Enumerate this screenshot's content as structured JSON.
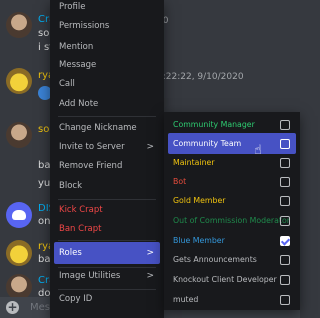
{
  "chat": {
    "messages": [
      {
        "author": "Cra",
        "lines": [
          "sor",
          "i st"
        ],
        "stamp": "20"
      },
      {
        "author": "rya",
        "stamp": "2:22:22, 9/10/2020"
      },
      {
        "author": "soc",
        "lines": [
          "bar",
          "yuc"
        ],
        "stamp": "02"
      },
      {
        "author": "DIS",
        "lines": [
          "onl"
        ],
        "stamp": "40"
      },
      {
        "author": "rya",
        "lines": [
          "bar"
        ],
        "stamp": "0"
      },
      {
        "author": "Cra",
        "lines": [
          "dow"
        ],
        "stamp": "20"
      }
    ],
    "composer_placeholder": "Mess"
  },
  "menu": {
    "items": [
      {
        "label": "Profile"
      },
      {
        "label": "Permissions"
      },
      {
        "label": "Mention"
      },
      {
        "label": "Message"
      },
      {
        "label": "Call"
      },
      {
        "label": "Add Note"
      },
      {
        "label": "Change Nickname"
      },
      {
        "label": "Invite to Server",
        "chevron": ">"
      },
      {
        "label": "Remove Friend"
      },
      {
        "label": "Block"
      },
      {
        "label": "Kick Crapt"
      },
      {
        "label": "Ban Crapt"
      },
      {
        "label": "Roles",
        "chevron": ">"
      },
      {
        "label": "Image Utilities",
        "chevron": ">"
      },
      {
        "label": "Copy ID"
      }
    ]
  },
  "roles": {
    "items": [
      {
        "label": "Community Manager",
        "color": "#2ecc71",
        "checked": false
      },
      {
        "label": "Community Team",
        "color": "#ffffff",
        "checked": false
      },
      {
        "label": "Maintainer",
        "color": "#f1c40f",
        "checked": false
      },
      {
        "label": "Bot",
        "color": "#e74c3c",
        "checked": false
      },
      {
        "label": "Gold Member",
        "color": "#f1c40f",
        "checked": false
      },
      {
        "label": "Out of Commission Moderator",
        "color": "#1f8b4c",
        "checked": false
      },
      {
        "label": "Blue Member",
        "color": "#3498db",
        "checked": true
      },
      {
        "label": "Gets Announcements",
        "color": "#b9bbbe",
        "checked": false
      },
      {
        "label": "Knockout Client Developer",
        "color": "#b9bbbe",
        "checked": false
      },
      {
        "label": "muted",
        "color": "#b9bbbe",
        "checked": false
      }
    ]
  }
}
